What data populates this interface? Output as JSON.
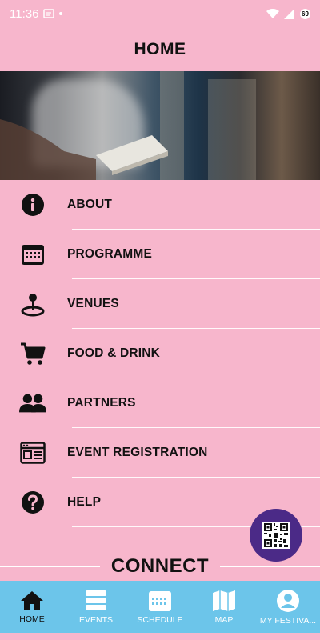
{
  "status": {
    "time": "11:36",
    "battery": "69"
  },
  "header": {
    "title": "HOME"
  },
  "menu": {
    "items": [
      {
        "label": "ABOUT",
        "icon": "info-icon"
      },
      {
        "label": "PROGRAMME",
        "icon": "calendar-icon"
      },
      {
        "label": "VENUES",
        "icon": "map-pin-icon"
      },
      {
        "label": "FOOD & DRINK",
        "icon": "cart-icon"
      },
      {
        "label": "PARTNERS",
        "icon": "people-icon"
      },
      {
        "label": "EVENT REGISTRATION",
        "icon": "form-icon"
      },
      {
        "label": "HELP",
        "icon": "help-icon"
      }
    ]
  },
  "connect": {
    "title": "CONNECT"
  },
  "nav": {
    "items": [
      {
        "label": "HOME",
        "icon": "home-icon",
        "active": true
      },
      {
        "label": "EVENTS",
        "icon": "events-icon",
        "active": false
      },
      {
        "label": "SCHEDULE",
        "icon": "schedule-icon",
        "active": false
      },
      {
        "label": "MAP",
        "icon": "map-icon",
        "active": false
      },
      {
        "label": "MY FESTIVA...",
        "icon": "profile-icon",
        "active": false
      }
    ]
  },
  "colors": {
    "background": "#f7b6cc",
    "nav_background": "#6cc5ea",
    "fab": "#4b2a87"
  }
}
